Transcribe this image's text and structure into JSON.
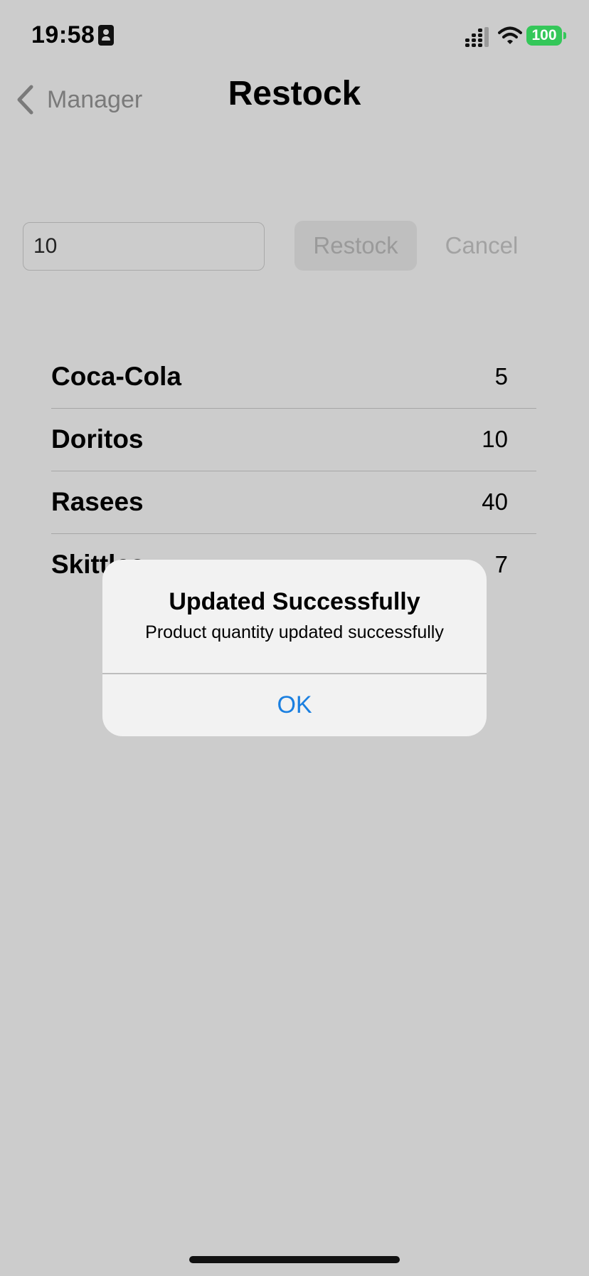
{
  "status_bar": {
    "time": "19:58",
    "battery": "100",
    "icons": [
      "id-card-icon",
      "cellular-signal-icon",
      "wifi-icon",
      "battery-icon"
    ],
    "battery_color": "#34c759"
  },
  "nav": {
    "back_label": "Manager",
    "back_icon": "chevron-left-icon",
    "title": "Restock"
  },
  "form": {
    "quantity_value": "10",
    "restock_label": "Restock",
    "cancel_label": "Cancel"
  },
  "products": [
    {
      "name": "Coca-Cola",
      "quantity": "5"
    },
    {
      "name": "Doritos",
      "quantity": "10"
    },
    {
      "name": "Rasees",
      "quantity": "40"
    },
    {
      "name": "Skittles",
      "quantity": "7"
    }
  ],
  "alert": {
    "title": "Updated Successfully",
    "message": "Product quantity updated successfully",
    "ok_label": "OK",
    "ok_color": "#1a7fe0"
  },
  "colors": {
    "background": "#cccccc",
    "alert_background": "#f2f2f2"
  }
}
